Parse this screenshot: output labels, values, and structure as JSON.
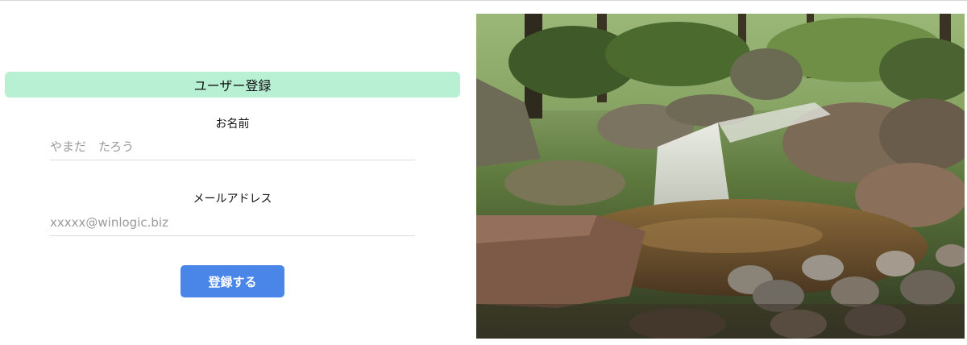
{
  "form": {
    "title": "ユーザー登録",
    "name_label": "お名前",
    "name_placeholder": "やまだ　たろう",
    "email_label": "メールアドレス",
    "email_placeholder": "xxxxx@winlogic.biz",
    "submit_label": "登録する"
  },
  "colors": {
    "title_bar": "#b8f0d4",
    "submit_button": "#4a86e8"
  },
  "image": {
    "subject": "forest-waterfall-photo"
  }
}
